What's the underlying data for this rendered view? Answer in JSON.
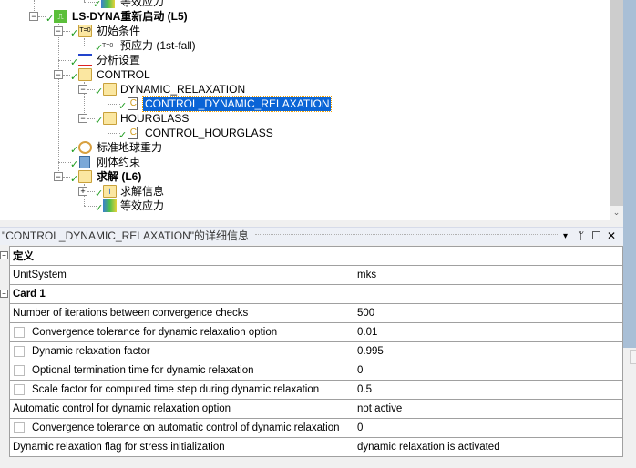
{
  "tree": {
    "items": [
      {
        "label": "等效应力"
      },
      {
        "label": "LS-DYNA重新启动 (L5)"
      },
      {
        "label": "初始条件"
      },
      {
        "label": "预应力 (1st-fall)"
      },
      {
        "label": "分析设置"
      },
      {
        "label": "CONTROL"
      },
      {
        "label": "DYNAMIC_RELAXATION"
      },
      {
        "label": "CONTROL_DYNAMIC_RELAXATION"
      },
      {
        "label": "HOURGLASS"
      },
      {
        "label": "CONTROL_HOURGLASS"
      },
      {
        "label": "标准地球重力"
      },
      {
        "label": "刚体约束"
      },
      {
        "label": "求解 (L6)"
      },
      {
        "label": "求解信息"
      },
      {
        "label": "等效应力"
      }
    ]
  },
  "panel": {
    "title": "\"CONTROL_DYNAMIC_RELAXATION\"的详细信息",
    "buttons": {
      "menu": "▾",
      "pin": "ᛘ",
      "maximize": "☐",
      "close": "✕"
    },
    "groups": [
      {
        "label": "定义",
        "rows": [
          {
            "key": "UnitSystem",
            "value": "mks"
          }
        ]
      },
      {
        "label": "Card 1",
        "rows": [
          {
            "key": "Number of iterations between convergence checks",
            "value": "500"
          },
          {
            "key": "Convergence tolerance for dynamic relaxation option",
            "value": "0.01"
          },
          {
            "key": "Dynamic relaxation factor",
            "value": "0.995"
          },
          {
            "key": "Optional termination time for dynamic relaxation",
            "value": "0"
          },
          {
            "key": "Scale factor for computed time step during dynamic relaxation",
            "value": "0.5"
          },
          {
            "key": "Automatic control for dynamic relaxation option",
            "value": "not active"
          },
          {
            "key": "Convergence tolerance on automatic control of dynamic relaxation",
            "value": "0"
          },
          {
            "key": "Dynamic relaxation flag for stress initialization",
            "value": "dynamic relaxation is activated"
          }
        ]
      }
    ]
  },
  "colors": {
    "selection": "#0a64d6",
    "check": "#1a9a1a",
    "side_strip": "#a9bfd6"
  }
}
